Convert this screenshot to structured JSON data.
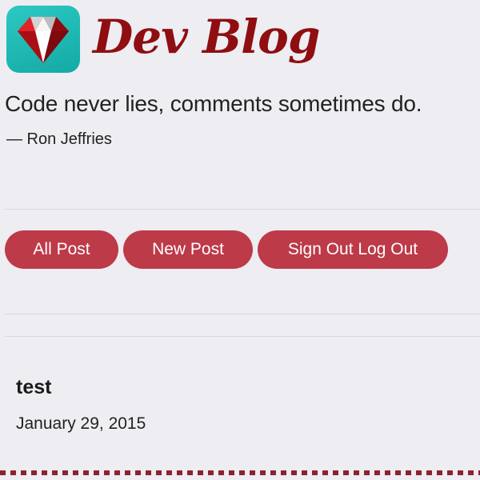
{
  "site": {
    "title": "Dev Blog",
    "logo": "ruby-gem-icon"
  },
  "quote": {
    "text": "Code never lies, comments sometimes do.",
    "attribution": "— Ron Jeffries"
  },
  "nav": {
    "all_post": "All Post",
    "new_post": "New Post",
    "sign_out": "Sign Out Log Out"
  },
  "post": {
    "title": "test",
    "date": "January 29, 2015"
  },
  "colors": {
    "background": "#ededf2",
    "brand_title": "#8f0e12",
    "button": "#bd3a48",
    "logo_bg": "#1cb8b2",
    "dashed_rule": "#8c2230"
  }
}
